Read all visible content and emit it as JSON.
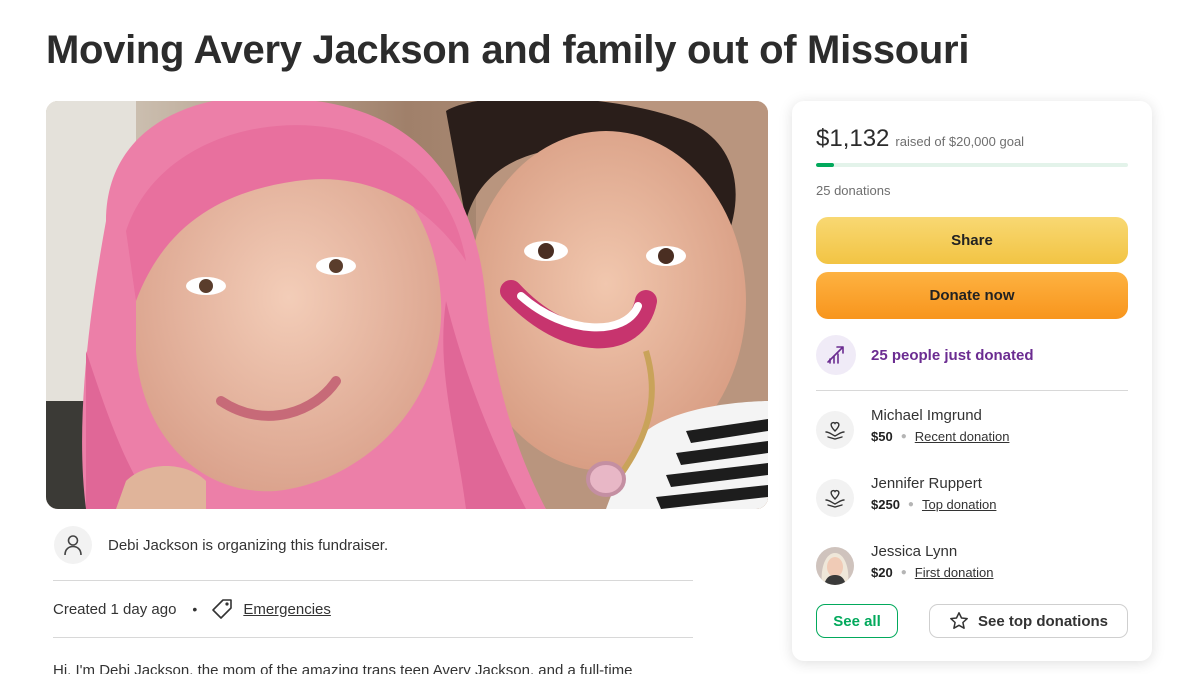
{
  "page": {
    "title": "Moving Avery Jackson and family out of Missouri"
  },
  "organizer": {
    "text": "Debi Jackson is organizing this fundraiser.",
    "icon": "person-icon"
  },
  "meta": {
    "created": "Created 1 day ago",
    "separator": "•",
    "category": "Emergencies",
    "category_icon": "tag-icon"
  },
  "story": {
    "first_line": "Hi, I'm Debi Jackson, the mom of the amazing trans teen Avery Jackson, and a full-time"
  },
  "donation_card": {
    "raised_amount": "$1,132",
    "goal_text": "raised of $20,000 goal",
    "progress_fraction": 0.0566,
    "donation_count": "25 donations",
    "share_label": "Share",
    "donate_label": "Donate now",
    "trend_text": "25 people just donated",
    "trend_icon": "trending-up-icon",
    "donors": [
      {
        "name": "Michael Imgrund",
        "amount": "$50",
        "kind": "Recent donation",
        "icon": "heart-hands-icon"
      },
      {
        "name": "Jennifer Ruppert",
        "amount": "$250",
        "kind": "Top donation",
        "icon": "heart-hands-icon"
      },
      {
        "name": "Jessica Lynn",
        "amount": "$20",
        "kind": "First donation",
        "icon": "avatar-photo"
      }
    ],
    "see_all_label": "See all",
    "see_top_label": "See top donations",
    "see_top_icon": "star-icon",
    "colors": {
      "accent_green": "#02a95c",
      "share_yellow": "#f2c444",
      "donate_orange": "#f8951d",
      "trend_purple": "#6b2c91"
    }
  }
}
